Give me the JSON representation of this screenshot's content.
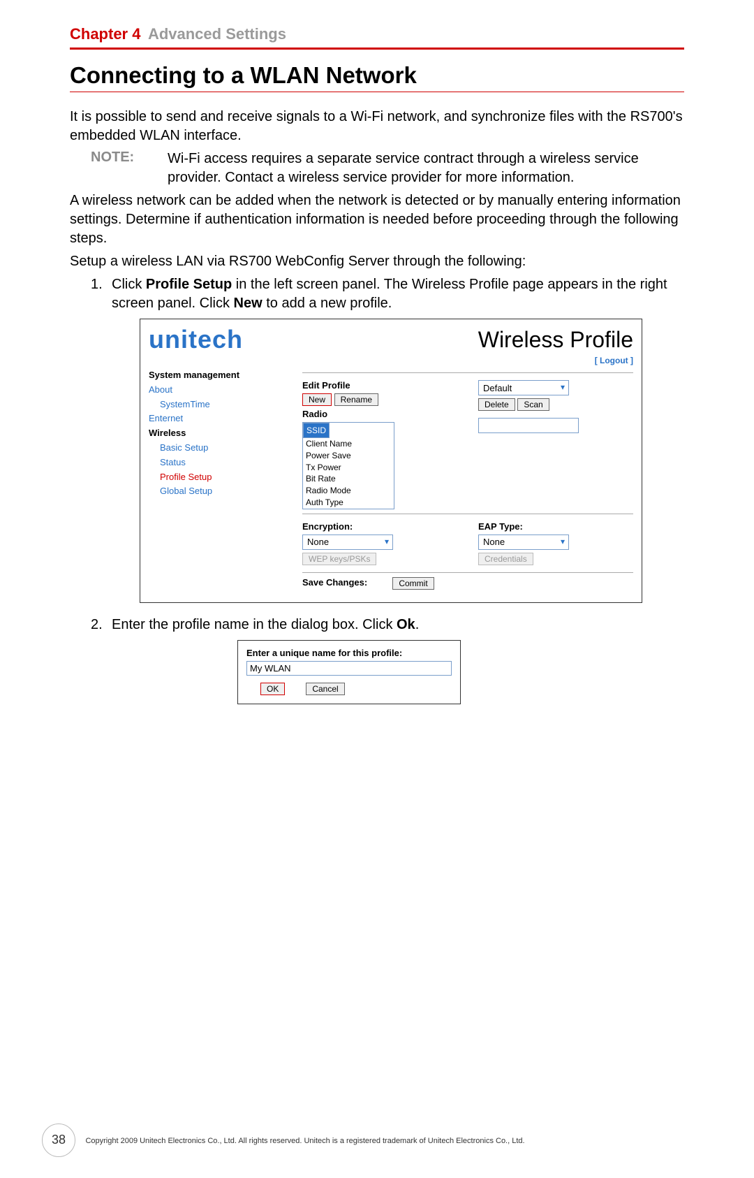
{
  "chapter": {
    "label": "Chapter 4",
    "title": "Advanced Settings"
  },
  "heading": "Connecting to a WLAN Network",
  "intro": "It is possible to send and receive signals to a Wi-Fi network, and synchronize files with the RS700's embedded WLAN interface.",
  "note": {
    "label": "NOTE:",
    "text": "Wi-Fi access requires a separate service contract through a wireless service provider. Contact a wireless service provider for more information."
  },
  "para2": "A wireless network can be added when the network is detected or by manually entering information settings. Determine if authentication information is needed before proceeding through the following steps.",
  "para3": "Setup a wireless LAN via RS700 WebConfig Server through the following:",
  "steps": {
    "s1_num": "1.",
    "s1_a": "Click ",
    "s1_b": "Profile Setup",
    "s1_c": " in the left screen panel. The Wireless Profile page appears in the right screen panel. Click ",
    "s1_d": "New",
    "s1_e": " to add a new profile.",
    "s2_num": "2.",
    "s2_a": "Enter the profile name in the dialog box. Click ",
    "s2_b": "Ok",
    "s2_c": "."
  },
  "shot1": {
    "logo": "unitech",
    "title": "Wireless Profile",
    "logout": "[ Logout ]",
    "nav": {
      "sys": "System management",
      "about": "About",
      "systime": "SystemTime",
      "ent": "Enternet",
      "wireless": "Wireless",
      "basic": "Basic Setup",
      "status": "Status",
      "profile": "Profile Setup",
      "global": "Global Setup"
    },
    "form": {
      "edit": "Edit Profile",
      "default": "Default",
      "new": "New",
      "rename": "Rename",
      "delete": "Delete",
      "scan": "Scan",
      "radio": "Radio",
      "opts": {
        "ssid": "SSID",
        "client": "Client Name",
        "power": "Power Save",
        "tx": "Tx Power",
        "bit": "Bit Rate",
        "mode": "Radio Mode",
        "auth": "Auth Type"
      },
      "enc": "Encryption:",
      "eap": "EAP Type:",
      "none": "None",
      "wep": "WEP keys/PSKs",
      "cred": "Credentials",
      "save": "Save Changes:",
      "commit": "Commit"
    }
  },
  "shot2": {
    "prompt": "Enter a unique name for this profile:",
    "value": "My WLAN",
    "ok": "OK",
    "cancel": "Cancel"
  },
  "footer": {
    "page": "38",
    "copy": "Copyright 2009 Unitech Electronics Co., Ltd. All rights reserved. Unitech is a registered trademark of Unitech Electronics Co., Ltd."
  }
}
